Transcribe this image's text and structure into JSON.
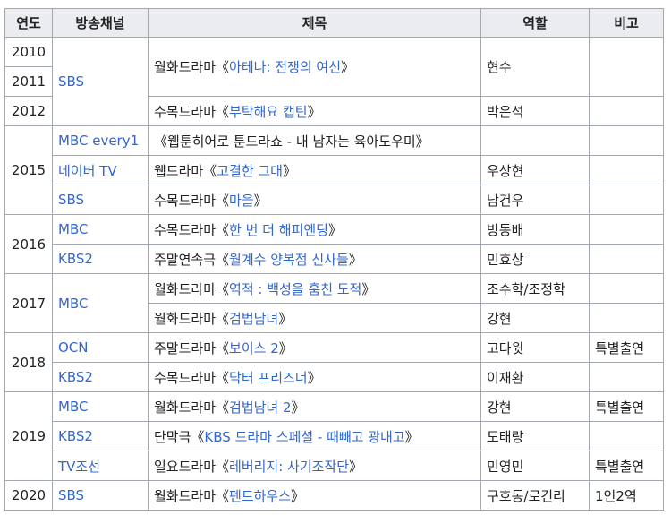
{
  "headers": {
    "year": "연도",
    "channel": "방송채널",
    "title": "제목",
    "role": "역할",
    "note": "비고"
  },
  "years": {
    "y2010": "2010",
    "y2011": "2011",
    "y2012": "2012",
    "y2015": "2015",
    "y2016": "2016",
    "y2017": "2017",
    "y2018": "2018",
    "y2019": "2019",
    "y2020": "2020"
  },
  "channels": {
    "c1": "SBS",
    "c2": "MBC every1",
    "c3": "네이버 TV",
    "c4": "SBS",
    "c5": "MBC",
    "c6": "KBS2",
    "c7": "MBC",
    "c8": "OCN",
    "c9": "KBS2",
    "c10": "MBC",
    "c11": "KBS2",
    "c12": "TV조선",
    "c13": "SBS"
  },
  "titles": {
    "t1": {
      "prefix": "월화드라마",
      "open": "《",
      "name": "아테나: 전쟁의 여신",
      "close": "》"
    },
    "t2": {
      "prefix": "수목드라마",
      "open": "《",
      "name": "부탁해요 캡틴",
      "close": "》"
    },
    "t3": {
      "prefix": "",
      "open": "《",
      "name": "웹툰히어로 툰드라쇼 - 내 남자는 육아도우미",
      "close": "》"
    },
    "t4": {
      "prefix": "웹드라마",
      "open": "《",
      "name": "고결한 그대",
      "close": "》"
    },
    "t5": {
      "prefix": "수목드라마",
      "open": "《",
      "name": "마을",
      "close": "》"
    },
    "t6": {
      "prefix": "수목드라마",
      "open": "《",
      "name": "한 번 더 해피엔딩",
      "close": "》"
    },
    "t7": {
      "prefix": "주말연속극",
      "open": "《",
      "name": "월계수 양복점 신사들",
      "close": "》"
    },
    "t8": {
      "prefix": "월화드라마",
      "open": "《",
      "name": "역적 : 백성을 훔친 도적",
      "close": "》"
    },
    "t9": {
      "prefix": "월화드라마",
      "open": "《",
      "name": "검법남녀",
      "close": "》"
    },
    "t10": {
      "prefix": "주말드라마",
      "open": "《",
      "name": "보이스 2",
      "close": "》"
    },
    "t11": {
      "prefix": "수목드라마",
      "open": "《",
      "name": "닥터 프리즈너",
      "close": "》"
    },
    "t12": {
      "prefix": "월화드라마",
      "open": "《",
      "name": "검법남녀 2",
      "close": "》"
    },
    "t13": {
      "prefix": "단막극",
      "open": "《",
      "name": "KBS 드라마 스페셜 - 때빼고 광내고",
      "close": "》"
    },
    "t14": {
      "prefix": "일요드라마",
      "open": "《",
      "name": "레버리지: 사기조작단",
      "close": "》"
    },
    "t15": {
      "prefix": "월화드라마",
      "open": "《",
      "name": "펜트하우스",
      "close": "》"
    }
  },
  "roles": {
    "r1": "현수",
    "r2": "박은석",
    "r3": "",
    "r4": "우상현",
    "r5": "남건우",
    "r6": "방동배",
    "r7": "민효상",
    "r8": "조수학/조정학",
    "r9": "강현",
    "r10": "고다윗",
    "r11": "이재환",
    "r12": "강현",
    "r13": "도태랑",
    "r14": "민영민",
    "r15": "구호동/로건리"
  },
  "notes": {
    "n10": "특별출연",
    "n12": "특별출연",
    "n14": "특별출연",
    "n15": "1인2역"
  }
}
